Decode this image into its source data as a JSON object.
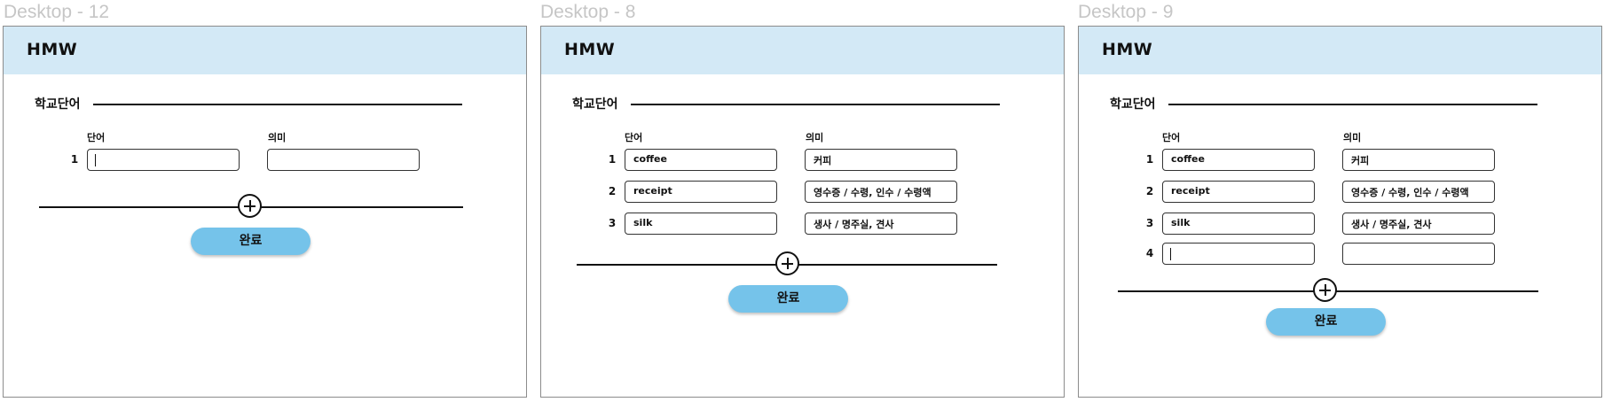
{
  "frames": [
    {
      "label": "Desktop - 12",
      "logo": "HMW",
      "section_title": "학교단어",
      "col_word": "단어",
      "col_meaning": "의미",
      "done_label": "완료",
      "rows": [
        {
          "num": "1",
          "word": "",
          "meaning": "",
          "focused": true
        }
      ]
    },
    {
      "label": "Desktop - 8",
      "logo": "HMW",
      "section_title": "학교단어",
      "col_word": "단어",
      "col_meaning": "의미",
      "done_label": "완료",
      "rows": [
        {
          "num": "1",
          "word": "coffee",
          "meaning": "커피"
        },
        {
          "num": "2",
          "word": "receipt",
          "meaning": "영수증 / 수령, 인수 / 수령액"
        },
        {
          "num": "3",
          "word": "silk",
          "meaning": "생사 / 명주실, 견사"
        }
      ]
    },
    {
      "label": "Desktop - 9",
      "logo": "HMW",
      "section_title": "학교단어",
      "col_word": "단어",
      "col_meaning": "의미",
      "done_label": "완료",
      "rows": [
        {
          "num": "1",
          "word": "coffee",
          "meaning": "커피"
        },
        {
          "num": "2",
          "word": "receipt",
          "meaning": "영수증 / 수령, 인수 / 수령액"
        },
        {
          "num": "3",
          "word": "silk",
          "meaning": "생사 / 명주실, 견사"
        },
        {
          "num": "4",
          "word": "",
          "meaning": "",
          "focused": true
        }
      ]
    }
  ]
}
